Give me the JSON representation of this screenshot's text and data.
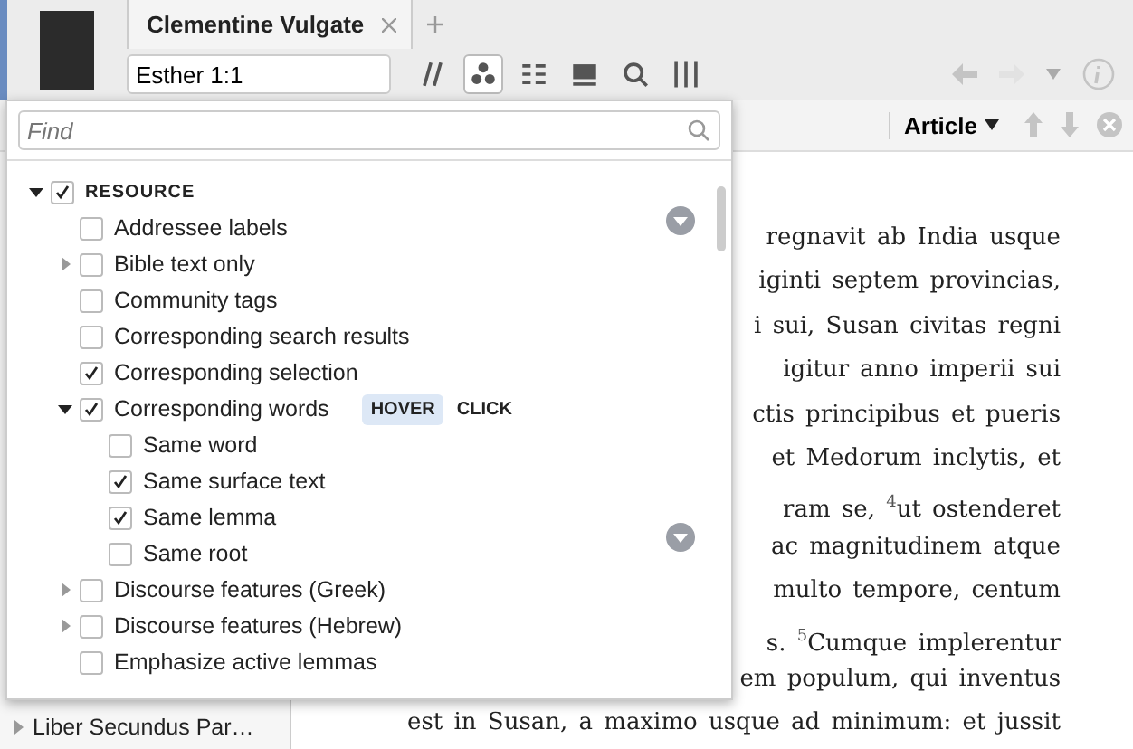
{
  "tabs": [
    {
      "label": "Clementine Vulgate"
    }
  ],
  "reference_field": {
    "value": "Esther 1:1"
  },
  "toolbar_tools": [
    {
      "kind": "parallel",
      "selected": false
    },
    {
      "kind": "dots",
      "selected": true
    },
    {
      "kind": "list",
      "selected": false
    },
    {
      "kind": "panel",
      "selected": false
    },
    {
      "kind": "search",
      "selected": false
    },
    {
      "kind": "columns",
      "selected": false
    }
  ],
  "nav_buttons": [
    {
      "kind": "back",
      "disabled": false
    },
    {
      "kind": "forward",
      "disabled": true
    },
    {
      "kind": "dropdown",
      "disabled": false
    },
    {
      "kind": "info",
      "disabled": false
    }
  ],
  "view_bar": {
    "menu_label": "Article"
  },
  "sidebar": {
    "items": [
      {
        "label": "Liber Secundus Par…",
        "expanded": false
      }
    ]
  },
  "text_lines": [
    {
      "text": "regnavit ab India usque"
    },
    {
      "text": "iginti septem provincias,"
    },
    {
      "text": "i sui, Susan civitas regni"
    },
    {
      "text": "igitur anno imperii sui"
    },
    {
      "text": "ctis principibus et pueris"
    },
    {
      "text": "et Medorum inclytis, et"
    },
    {
      "text": "ram se, $^{4}$ut ostenderet"
    },
    {
      "text": "ac magnitudinem atque"
    },
    {
      "text": "multo tempore, centum"
    },
    {
      "text": "s. $^{5}$Cumque implerentur"
    },
    {
      "text": "em populum, qui inventus"
    },
    {
      "text": "est in Susan, a maximo usque ad minimum: et jussit"
    }
  ],
  "filter_popup": {
    "find_placeholder": "Find",
    "tree": [
      {
        "label": "RESOURCE",
        "checked": true,
        "expanded": true,
        "children": [
          {
            "label": "Addressee labels",
            "checked": false
          },
          {
            "label": "Bible text only",
            "checked": false,
            "expanded": false
          },
          {
            "label": "Community tags",
            "checked": false
          },
          {
            "label": "Corresponding search results",
            "checked": false
          },
          {
            "label": "Corresponding selection",
            "checked": true
          },
          {
            "label": "Corresponding words",
            "checked": true,
            "expanded": true,
            "modes": [
              {
                "label": "HOVER",
                "selected": true
              },
              {
                "label": "CLICK",
                "selected": false
              }
            ],
            "children": [
              {
                "label": "Same word",
                "checked": false
              },
              {
                "label": "Same surface text",
                "checked": true
              },
              {
                "label": "Same lemma",
                "checked": true
              },
              {
                "label": "Same root",
                "checked": false
              }
            ]
          },
          {
            "label": "Discourse features (Greek)",
            "checked": false,
            "expanded": false
          },
          {
            "label": "Discourse features (Hebrew)",
            "checked": false,
            "expanded": false
          },
          {
            "label": "Emphasize active lemmas",
            "checked": false
          }
        ]
      }
    ]
  }
}
